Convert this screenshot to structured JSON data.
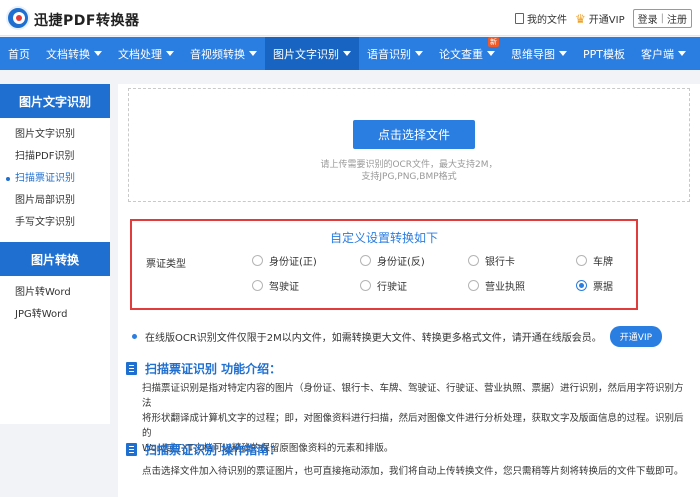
{
  "header": {
    "brand": "迅捷PDF转换器",
    "links": {
      "my_files": "我的文件",
      "vip": "开通VIP",
      "login": "登录",
      "register": "注册"
    }
  },
  "nav": {
    "items": [
      {
        "label": "首页",
        "caret": false
      },
      {
        "label": "文档转换",
        "caret": true
      },
      {
        "label": "文档处理",
        "caret": true
      },
      {
        "label": "音视频转换",
        "caret": true
      },
      {
        "label": "图片文字识别",
        "caret": true,
        "active": true
      },
      {
        "label": "语音识别",
        "caret": true
      },
      {
        "label": "论文查重",
        "caret": true,
        "badge": "新"
      },
      {
        "label": "思维导图",
        "caret": true
      },
      {
        "label": "PPT模板",
        "caret": false
      },
      {
        "label": "客户端",
        "caret": true
      }
    ]
  },
  "sidebar": {
    "group1": {
      "title": "图片文字识别",
      "items": [
        "图片文字识别",
        "扫描PDF识别",
        "扫描票证识别",
        "图片局部识别",
        "手写文字识别"
      ],
      "active_index": 2
    },
    "group2": {
      "title": "图片转换",
      "items": [
        "图片转Word",
        "JPG转Word"
      ]
    }
  },
  "upload": {
    "button": "点击选择文件",
    "hint_line1": "请上传需要识别的OCR文件，最大支持2M，",
    "hint_line2": "支持JPG,PNG,BMP格式"
  },
  "settings": {
    "title": "自定义设置转换如下",
    "label": "票证类型",
    "options": [
      "身份证(正)",
      "身份证(反)",
      "银行卡",
      "车牌",
      "驾驶证",
      "行驶证",
      "营业执照",
      "票据"
    ],
    "selected": "票据"
  },
  "notice": {
    "text": "在线版OCR识别文件仅限于2M以内文件，如需转换更大文件、转换更多格式文件，请开通在线版会员。",
    "button": "开通VIP"
  },
  "intro": {
    "title": "扫描票证识别 功能介绍：",
    "line1": "扫描票证识别是指对特定内容的图片（身份证、银行卡、车牌、驾驶证、行驶证、营业执照、票据）进行识别，然后用字符识别方法",
    "line2": "将形状翻译成计算机文字的过程；即，对图像资料进行扫描，然后对图像文件进行分析处理，获取文字及版面信息的过程。识别后的",
    "line3": "Word或TXT文档可以精确的保留原图像资料的元素和排版。"
  },
  "guide": {
    "title": "扫描票证识别 操作指南：",
    "line1": "点击选择文件加入待识别的票证图片，也可直接拖动添加，我们将自动上传转换文件，您只需稍等片刻将转换后的文件下载即可。"
  },
  "colors": {
    "primary": "#2a7de1",
    "active_nav": "#1864c2",
    "highlight_border": "#e03c3c",
    "badge": "#f05a28"
  }
}
